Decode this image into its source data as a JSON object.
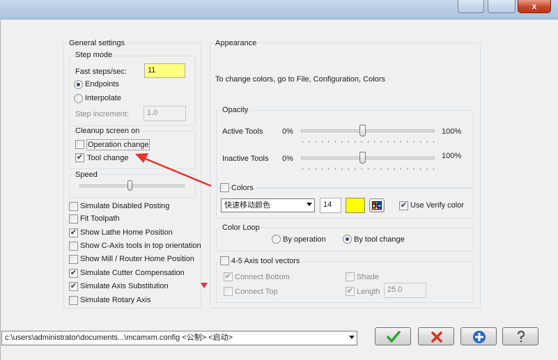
{
  "window": {
    "close_glyph": "x"
  },
  "general": {
    "title": "General settings",
    "step_mode": {
      "title": "Step mode",
      "fast_steps_label": "Fast steps/sec:",
      "fast_steps_value": "11",
      "endpoints_label": "Endpoints",
      "interpolate_label": "Interpolate",
      "selected": "Endpoints",
      "step_increment_label": "Step increment:",
      "step_increment_value": "1.0"
    },
    "cleanup": {
      "title": "Cleanup screen on",
      "operation_change_label": "Operation change",
      "operation_change_checked": false,
      "tool_change_label": "Tool change",
      "tool_change_checked": true
    },
    "speed": {
      "title": "Speed",
      "level": 0.48
    },
    "options": [
      {
        "label": "Simulate Disabled Posting",
        "checked": false
      },
      {
        "label": "Fit Toolpath",
        "checked": false
      },
      {
        "label": "Show Lathe Home Position",
        "checked": true
      },
      {
        "label": "Show C-Axis tools in top orientation",
        "checked": false
      },
      {
        "label": "Show Mill / Router Home Position",
        "checked": false
      },
      {
        "label": "Simulate Cutter Compensation",
        "checked": true
      },
      {
        "label": "Simulate Axis Substitution",
        "checked": true
      },
      {
        "label": "Simulate Rotary Axis",
        "checked": false
      }
    ]
  },
  "appearance": {
    "title": "Appearance",
    "hint": "To change colors, go to File, Configuration, Colors",
    "opacity": {
      "title": "Opacity",
      "active_label": "Active Tools",
      "active_min": "0%",
      "active_max": "100%",
      "active_level": 0.46,
      "inactive_label": "Inactive Tools",
      "inactive_min": "0%",
      "inactive_max": "100%",
      "inactive_level": 0.46
    },
    "colors": {
      "label": "Colors",
      "checked": false,
      "dropdown_value": "快速移动颜色",
      "number_value": "14",
      "swatch_color": "#ffff00",
      "use_verify_label": "Use Verify color",
      "use_verify_checked": true
    },
    "color_loop": {
      "title": "Color Loop",
      "by_operation_label": "By operation",
      "by_tool_change_label": "By tool change",
      "selected": "By tool change"
    },
    "axis_vectors": {
      "label": "4-5 Axis tool vectors",
      "checked": false,
      "connect_bottom_label": "Connect Bottom",
      "connect_bottom_checked": true,
      "connect_top_label": "Connect Top",
      "connect_top_checked": false,
      "shade_label": "Shade",
      "shade_checked": false,
      "length_label": "Length",
      "length_checked": true,
      "length_value": "25.0"
    }
  },
  "footer": {
    "config_path": "c:\\users\\administrator\\documents...\\mcamxm.config <公制> <启动>"
  },
  "colors": {
    "input_highlight": "#ffff80",
    "arrow_red": "#e8322a",
    "ok_green": "#2aa82a",
    "cancel_red": "#d8341c",
    "add_blue": "#2a66c8"
  },
  "icons": {
    "ok": "checkmark-icon",
    "cancel": "x-icon",
    "add": "plus-icon",
    "help": "question-icon"
  }
}
